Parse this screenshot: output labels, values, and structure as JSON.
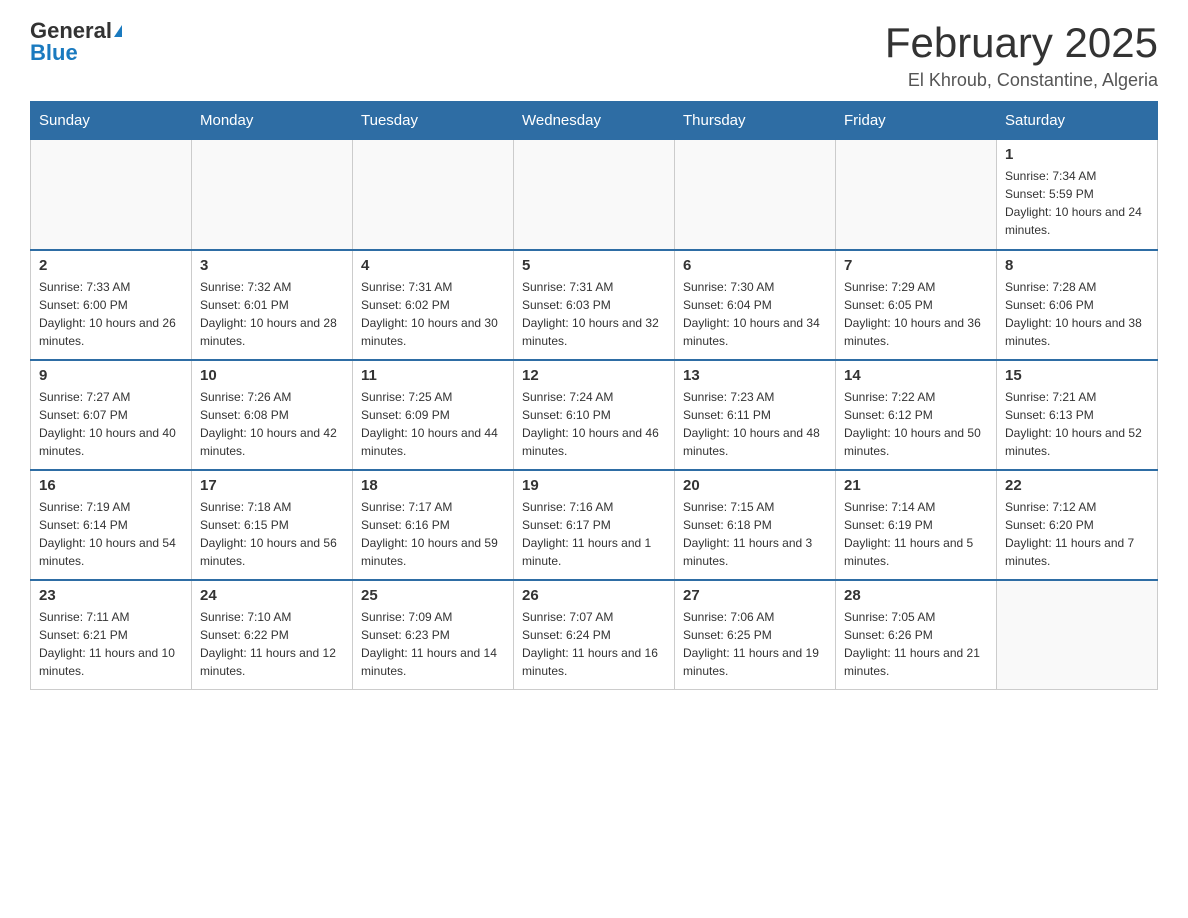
{
  "logo": {
    "general": "General",
    "blue": "Blue"
  },
  "title": "February 2025",
  "location": "El Khroub, Constantine, Algeria",
  "days_of_week": [
    "Sunday",
    "Monday",
    "Tuesday",
    "Wednesday",
    "Thursday",
    "Friday",
    "Saturday"
  ],
  "weeks": [
    [
      {
        "day": "",
        "info": ""
      },
      {
        "day": "",
        "info": ""
      },
      {
        "day": "",
        "info": ""
      },
      {
        "day": "",
        "info": ""
      },
      {
        "day": "",
        "info": ""
      },
      {
        "day": "",
        "info": ""
      },
      {
        "day": "1",
        "info": "Sunrise: 7:34 AM\nSunset: 5:59 PM\nDaylight: 10 hours and 24 minutes."
      }
    ],
    [
      {
        "day": "2",
        "info": "Sunrise: 7:33 AM\nSunset: 6:00 PM\nDaylight: 10 hours and 26 minutes."
      },
      {
        "day": "3",
        "info": "Sunrise: 7:32 AM\nSunset: 6:01 PM\nDaylight: 10 hours and 28 minutes."
      },
      {
        "day": "4",
        "info": "Sunrise: 7:31 AM\nSunset: 6:02 PM\nDaylight: 10 hours and 30 minutes."
      },
      {
        "day": "5",
        "info": "Sunrise: 7:31 AM\nSunset: 6:03 PM\nDaylight: 10 hours and 32 minutes."
      },
      {
        "day": "6",
        "info": "Sunrise: 7:30 AM\nSunset: 6:04 PM\nDaylight: 10 hours and 34 minutes."
      },
      {
        "day": "7",
        "info": "Sunrise: 7:29 AM\nSunset: 6:05 PM\nDaylight: 10 hours and 36 minutes."
      },
      {
        "day": "8",
        "info": "Sunrise: 7:28 AM\nSunset: 6:06 PM\nDaylight: 10 hours and 38 minutes."
      }
    ],
    [
      {
        "day": "9",
        "info": "Sunrise: 7:27 AM\nSunset: 6:07 PM\nDaylight: 10 hours and 40 minutes."
      },
      {
        "day": "10",
        "info": "Sunrise: 7:26 AM\nSunset: 6:08 PM\nDaylight: 10 hours and 42 minutes."
      },
      {
        "day": "11",
        "info": "Sunrise: 7:25 AM\nSunset: 6:09 PM\nDaylight: 10 hours and 44 minutes."
      },
      {
        "day": "12",
        "info": "Sunrise: 7:24 AM\nSunset: 6:10 PM\nDaylight: 10 hours and 46 minutes."
      },
      {
        "day": "13",
        "info": "Sunrise: 7:23 AM\nSunset: 6:11 PM\nDaylight: 10 hours and 48 minutes."
      },
      {
        "day": "14",
        "info": "Sunrise: 7:22 AM\nSunset: 6:12 PM\nDaylight: 10 hours and 50 minutes."
      },
      {
        "day": "15",
        "info": "Sunrise: 7:21 AM\nSunset: 6:13 PM\nDaylight: 10 hours and 52 minutes."
      }
    ],
    [
      {
        "day": "16",
        "info": "Sunrise: 7:19 AM\nSunset: 6:14 PM\nDaylight: 10 hours and 54 minutes."
      },
      {
        "day": "17",
        "info": "Sunrise: 7:18 AM\nSunset: 6:15 PM\nDaylight: 10 hours and 56 minutes."
      },
      {
        "day": "18",
        "info": "Sunrise: 7:17 AM\nSunset: 6:16 PM\nDaylight: 10 hours and 59 minutes."
      },
      {
        "day": "19",
        "info": "Sunrise: 7:16 AM\nSunset: 6:17 PM\nDaylight: 11 hours and 1 minute."
      },
      {
        "day": "20",
        "info": "Sunrise: 7:15 AM\nSunset: 6:18 PM\nDaylight: 11 hours and 3 minutes."
      },
      {
        "day": "21",
        "info": "Sunrise: 7:14 AM\nSunset: 6:19 PM\nDaylight: 11 hours and 5 minutes."
      },
      {
        "day": "22",
        "info": "Sunrise: 7:12 AM\nSunset: 6:20 PM\nDaylight: 11 hours and 7 minutes."
      }
    ],
    [
      {
        "day": "23",
        "info": "Sunrise: 7:11 AM\nSunset: 6:21 PM\nDaylight: 11 hours and 10 minutes."
      },
      {
        "day": "24",
        "info": "Sunrise: 7:10 AM\nSunset: 6:22 PM\nDaylight: 11 hours and 12 minutes."
      },
      {
        "day": "25",
        "info": "Sunrise: 7:09 AM\nSunset: 6:23 PM\nDaylight: 11 hours and 14 minutes."
      },
      {
        "day": "26",
        "info": "Sunrise: 7:07 AM\nSunset: 6:24 PM\nDaylight: 11 hours and 16 minutes."
      },
      {
        "day": "27",
        "info": "Sunrise: 7:06 AM\nSunset: 6:25 PM\nDaylight: 11 hours and 19 minutes."
      },
      {
        "day": "28",
        "info": "Sunrise: 7:05 AM\nSunset: 6:26 PM\nDaylight: 11 hours and 21 minutes."
      },
      {
        "day": "",
        "info": ""
      }
    ]
  ]
}
